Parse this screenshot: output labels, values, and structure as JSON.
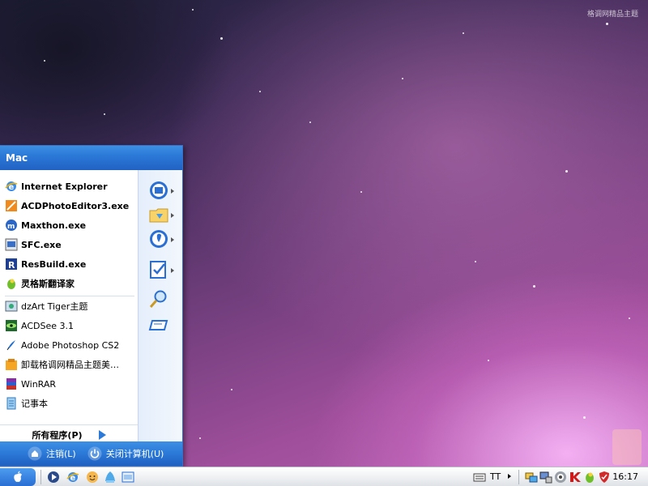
{
  "desktop": {
    "watermark": "格调网精品主题"
  },
  "start_menu": {
    "user_name": "Mac",
    "pinned": [
      {
        "label": "Internet Explorer",
        "icon": "internet-explorer-icon"
      },
      {
        "label": "ACDPhotoEditor3.exe",
        "icon": "acd-photo-editor-icon"
      },
      {
        "label": "Maxthon.exe",
        "icon": "maxthon-icon"
      },
      {
        "label": "SFC.exe",
        "icon": "sfc-icon"
      },
      {
        "label": "ResBuild.exe",
        "icon": "resbuild-icon"
      },
      {
        "label": "灵格斯翻译家",
        "icon": "lingoes-icon"
      }
    ],
    "recent": [
      {
        "label": "dzArt Tiger主题",
        "icon": "dzart-icon"
      },
      {
        "label": "ACDSee 3.1",
        "icon": "acdsee-icon"
      },
      {
        "label": "Adobe Photoshop CS2",
        "icon": "photoshop-icon"
      },
      {
        "label": "卸载格调网精品主题美…",
        "icon": "uninstall-icon"
      },
      {
        "label": "WinRAR",
        "icon": "winrar-icon"
      },
      {
        "label": "记事本",
        "icon": "notepad-icon"
      }
    ],
    "all_programs_label": "所有程序(P)",
    "right_icons": [
      "my-documents-icon",
      "my-pictures-icon",
      "my-music-icon",
      "control-panel-icon",
      "search-icon",
      "run-icon"
    ],
    "logoff_label": "注销(L)",
    "shutdown_label": "关闭计算机(U)"
  },
  "taskbar": {
    "quick_launch": [
      "media-player-icon",
      "internet-explorer-icon",
      "messenger-icon",
      "qq-icon",
      "show-desktop-icon"
    ],
    "language_indicator": "TT",
    "tray_icons": [
      "network-icon",
      "display-icon",
      "sound-icon",
      "antivirus-icon",
      "lingoes-tray-icon",
      "security-shield-icon"
    ],
    "clock": "16:17"
  },
  "colors": {
    "start_menu_blue": "#2b79d8",
    "start_menu_right_panel": "#e4eefb",
    "taskbar": "#eef0f2"
  }
}
